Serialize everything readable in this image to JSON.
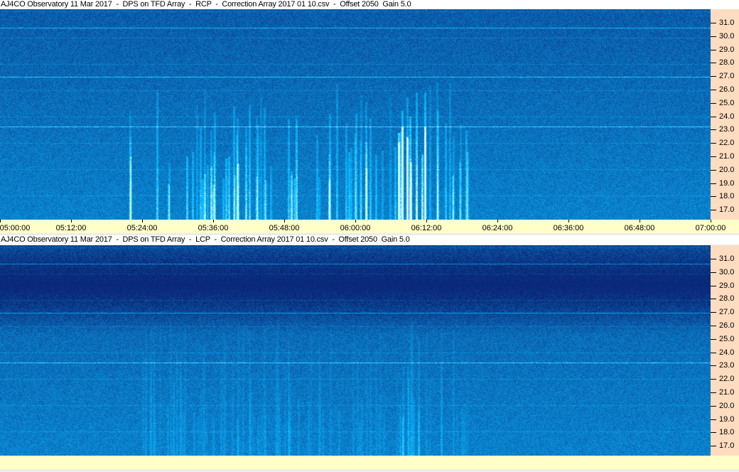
{
  "panels": [
    {
      "title": "AJ4CO Observatory 11 Mar 2017  -  DPS on TFD Array  -  RCP  -  Correction Array 2017 01 10.csv  -  Offset 2050  Gain 5.0",
      "polarization": "RCP"
    },
    {
      "title": "AJ4CO Observatory 11 Mar 2017  -  DPS on TFD Array  -  LCP  -  Correction Array 2017 01 10.csv  -  Offset 2050  Gain 5.0",
      "polarization": "LCP"
    }
  ],
  "freq_ticks": [
    "31.0",
    "30.0",
    "29.0",
    "28.0",
    "27.0",
    "26.0",
    "25.0",
    "24.0",
    "23.0",
    "22.0",
    "21.0",
    "20.0",
    "19.0",
    "18.0",
    "17.0"
  ],
  "time_ticks": [
    "05:00:00",
    "05:12:00",
    "05:24:00",
    "05:36:00",
    "05:48:00",
    "06:00:00",
    "06:12:00",
    "06:24:00",
    "06:36:00",
    "06:48:00",
    "07:00:00"
  ]
}
